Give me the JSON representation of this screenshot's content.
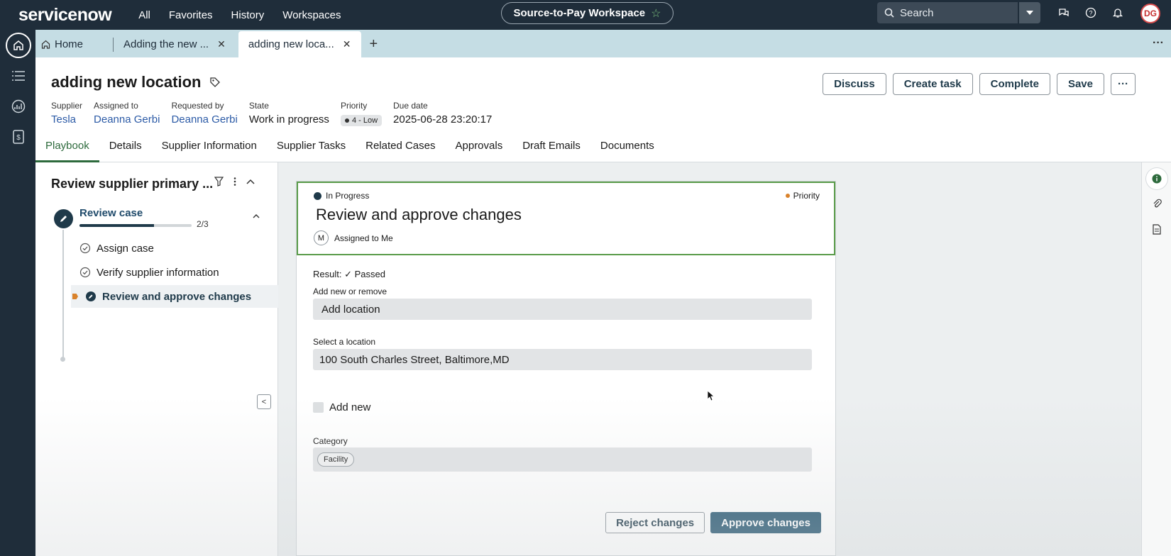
{
  "topbar": {
    "logo": "servicenow",
    "nav": [
      "All",
      "Favorites",
      "History",
      "Workspaces"
    ],
    "workspace": "Source-to-Pay Workspace",
    "search_placeholder": "Search",
    "avatar_initials": "DG"
  },
  "tabs": {
    "home": "Home",
    "tab1": "Adding the new ...",
    "tab2": "adding new loca..."
  },
  "record": {
    "title": "adding new location",
    "fields": [
      {
        "label": "Supplier",
        "value": "Tesla"
      },
      {
        "label": "Assigned to",
        "value": "Deanna Gerbi"
      },
      {
        "label": "Requested by",
        "value": "Deanna Gerbi"
      },
      {
        "label": "State",
        "value": "Work in progress"
      },
      {
        "label": "Priority",
        "value": "4 - Low"
      },
      {
        "label": "Due date",
        "value": "2025-06-28 23:20:17"
      }
    ],
    "buttons": {
      "discuss": "Discuss",
      "create_task": "Create task",
      "complete": "Complete",
      "save": "Save"
    }
  },
  "subtabs": [
    "Playbook",
    "Details",
    "Supplier Information",
    "Supplier Tasks",
    "Related Cases",
    "Approvals",
    "Draft Emails",
    "Documents"
  ],
  "playbook": {
    "title": "Review supplier primary ...",
    "stage": "Review case",
    "progress": 0.6667,
    "count": "2/3",
    "steps": [
      "Assign case",
      "Verify supplier information",
      "Review and approve changes"
    ]
  },
  "card": {
    "status": "In Progress",
    "priority": "Priority",
    "title": "Review and approve changes",
    "assignee_initial": "M",
    "assigned": "Assigned to Me",
    "result_label": "Result:",
    "result_value": "Passed",
    "field1_label": "Add new or remove",
    "field1_value": "Add location",
    "field2_label": "Select a location",
    "field2_value": "100 South Charles Street, Baltimore,MD",
    "checkbox_label": "Add new",
    "category_label": "Category",
    "category_chip": "Facility",
    "reject": "Reject changes",
    "approve": "Approve changes"
  },
  "colors": {
    "nav": "#1f2d3a",
    "accent": "#2d6a3c",
    "primary_btn": "#2b5a74",
    "priority": "#d9822b"
  }
}
